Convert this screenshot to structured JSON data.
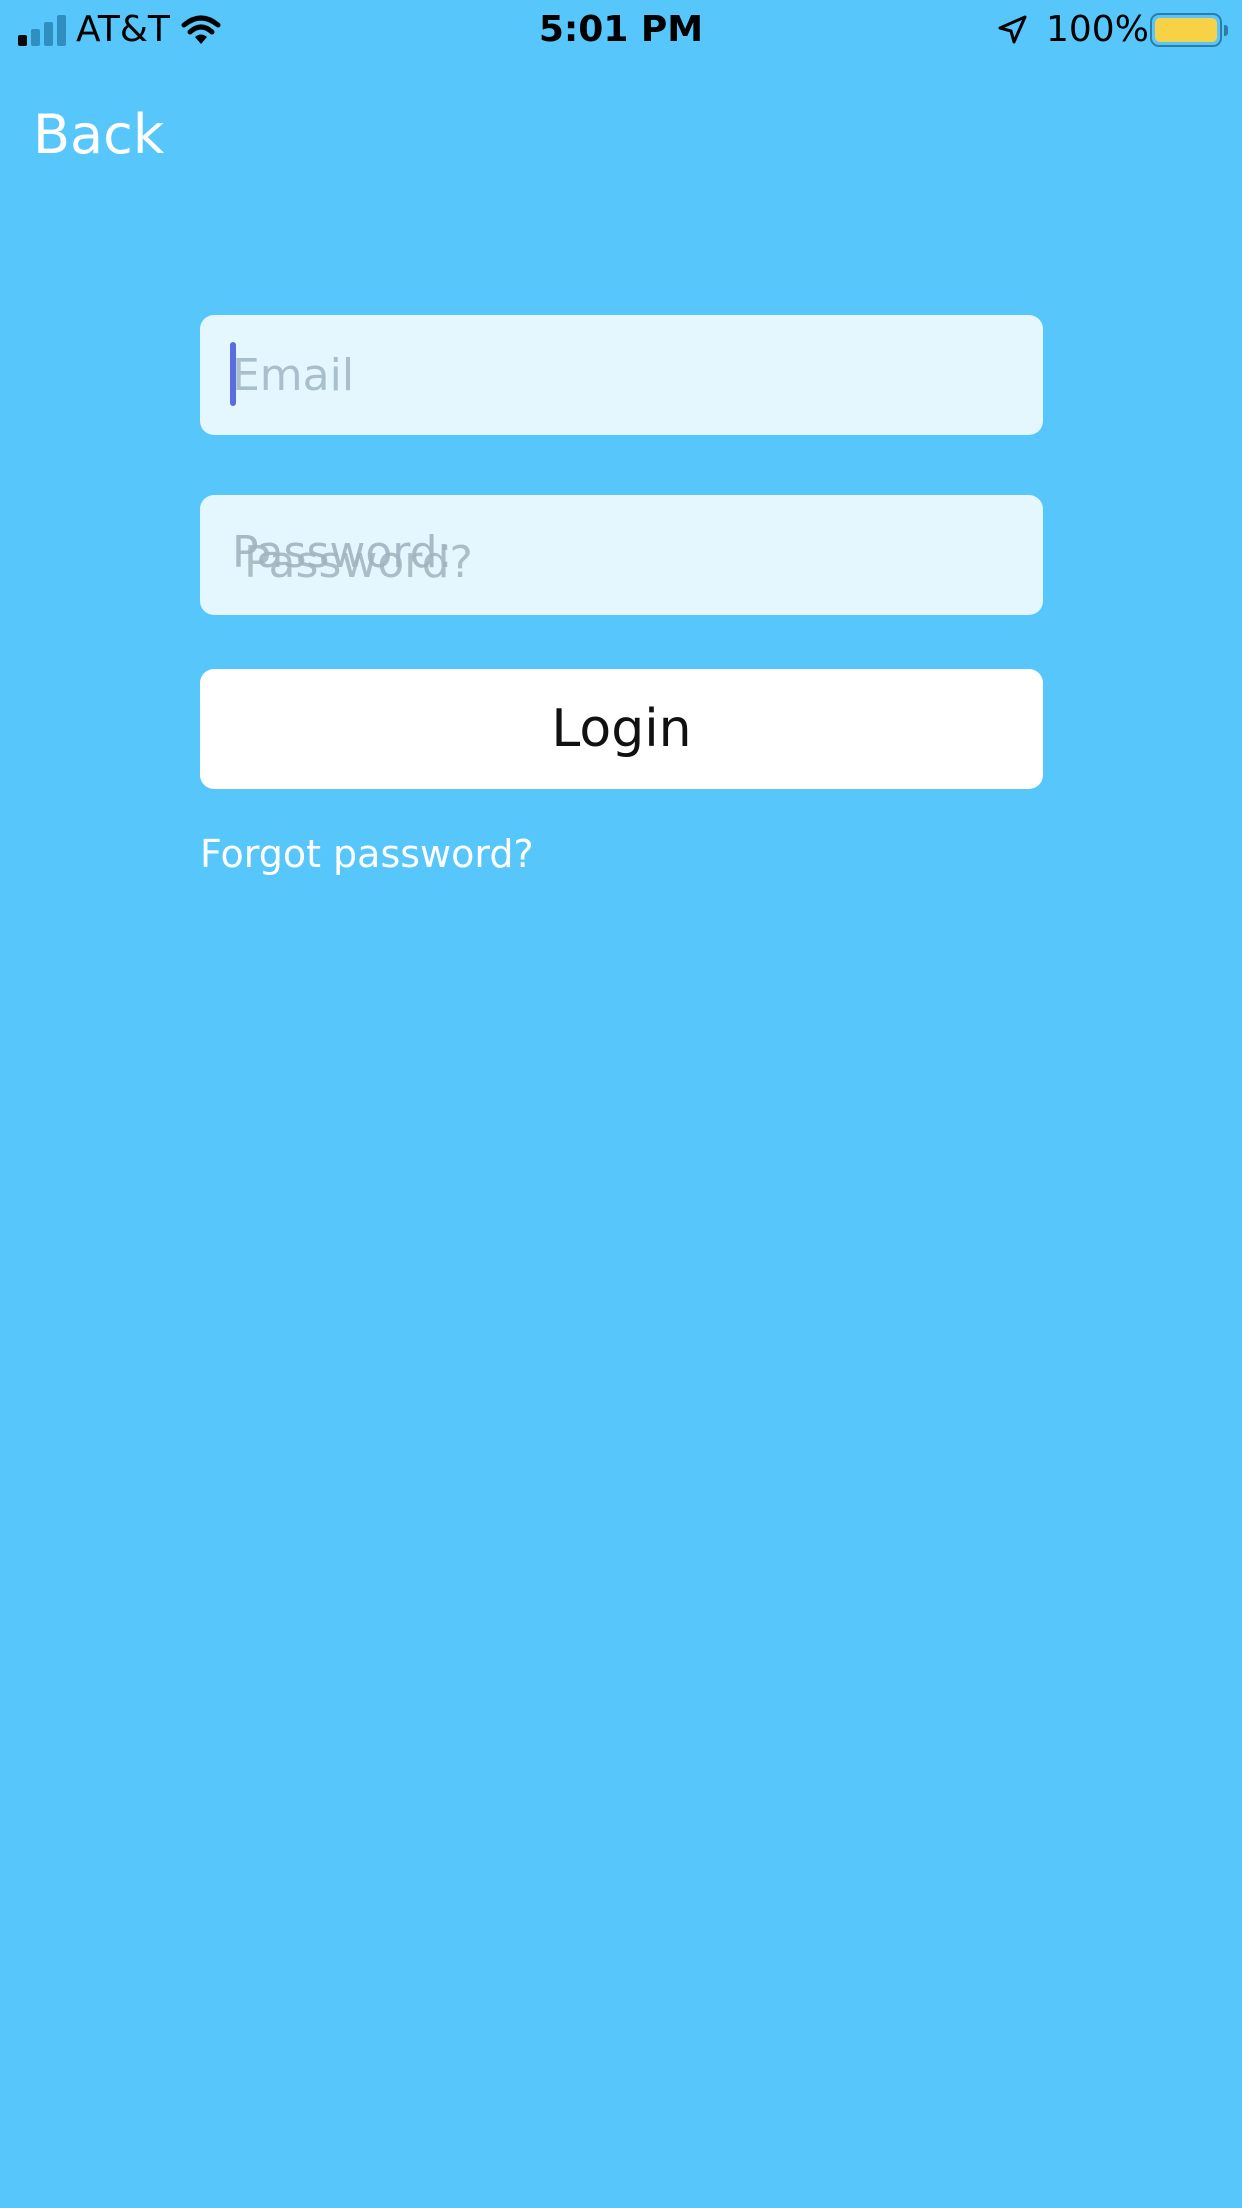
{
  "status_bar": {
    "carrier": "AT&T",
    "time": "5:01 PM",
    "battery_percent": "100%",
    "signal_bars_active": 1,
    "signal_bars_total": 4,
    "battery_level": 1.0,
    "battery_color": "#f8d246"
  },
  "nav": {
    "back_label": "Back"
  },
  "form": {
    "email_placeholder": "Email",
    "password_placeholder": "Password:",
    "password_hint": "Password?",
    "login_label": "Login",
    "forgot_label": "Forgot password?"
  },
  "colors": {
    "background": "#57c7fb",
    "field": "#e4f7ff",
    "caret": "#5b6be0",
    "button": "#ffffff"
  }
}
